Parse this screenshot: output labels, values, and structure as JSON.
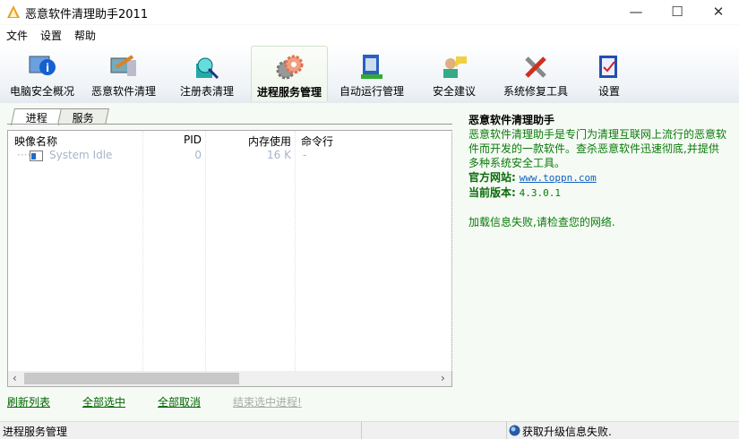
{
  "window": {
    "title": "恶意软件清理助手2011",
    "minimize": "—",
    "maximize": "☐",
    "close": "✕"
  },
  "menu": [
    "文件",
    "设置",
    "帮助"
  ],
  "toolbar": [
    {
      "label": "电脑安全概况",
      "icon": "computer-info-icon"
    },
    {
      "label": "恶意软件清理",
      "icon": "computer-broom-icon"
    },
    {
      "label": "注册表清理",
      "icon": "registry-icon"
    },
    {
      "label": "进程服务管理",
      "icon": "gears-icon"
    },
    {
      "label": "自动运行管理",
      "icon": "startup-icon"
    },
    {
      "label": "安全建议",
      "icon": "advice-user-icon"
    },
    {
      "label": "系统修复工具",
      "icon": "repair-tools-icon"
    },
    {
      "label": "设置",
      "icon": "settings-icon"
    }
  ],
  "selected_toolbar": "进程服务管理",
  "tabs": [
    "进程",
    "服务"
  ],
  "list": {
    "headers": [
      "映像名称",
      "PID",
      "内存使用",
      "命令行"
    ],
    "rows": [
      {
        "name": "System Idle",
        "pid": "0",
        "mem": "16 K",
        "cmd": "-"
      }
    ]
  },
  "actions": [
    "刷新列表",
    "全部选中",
    "全部取消",
    "结束选中进程!"
  ],
  "info": {
    "title": "恶意软件清理助手",
    "desc": "恶意软件清理助手是专门为清理互联网上流行的恶意软件而开发的一款软件。查杀恶意软件迅速彻底,并提供多种系统安全工具。",
    "site_label": "官方网站:",
    "site": "www.toppn.com",
    "version_label": "当前版本:",
    "version": "4.3.0.1",
    "error": "加载信息失败,请检查您的网络."
  },
  "status": {
    "left": "进程服务管理",
    "right": "获取升级信息失败."
  }
}
